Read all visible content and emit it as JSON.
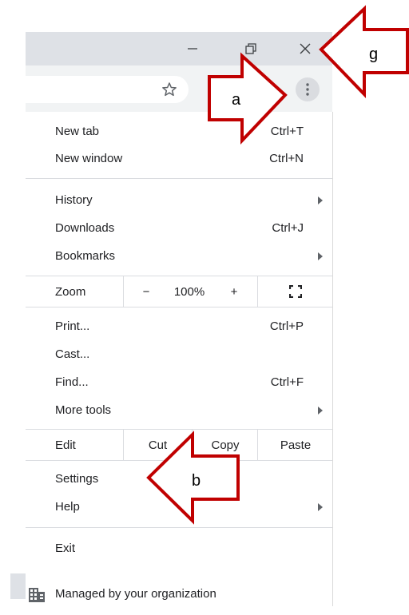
{
  "window": {
    "minimize_icon": "minimize-icon",
    "restore_icon": "restore-icon",
    "close_icon": "close-icon"
  },
  "toolbar": {
    "star_icon": "star-icon",
    "menu_icon": "three-dots-vertical-icon"
  },
  "menu": {
    "new_tab": {
      "label": "New tab",
      "shortcut": "Ctrl+T"
    },
    "new_window": {
      "label": "New window",
      "shortcut": "Ctrl+N"
    },
    "history": {
      "label": "History"
    },
    "downloads": {
      "label": "Downloads",
      "shortcut": "Ctrl+J"
    },
    "bookmarks": {
      "label": "Bookmarks"
    },
    "zoom": {
      "label": "Zoom",
      "minus": "−",
      "value": "100%",
      "plus": "+",
      "fullscreen_icon": "fullscreen-icon"
    },
    "print": {
      "label": "Print...",
      "shortcut": "Ctrl+P"
    },
    "cast": {
      "label": "Cast..."
    },
    "find": {
      "label": "Find...",
      "shortcut": "Ctrl+F"
    },
    "more_tools": {
      "label": "More tools"
    },
    "edit": {
      "label": "Edit",
      "cut": "Cut",
      "copy": "Copy",
      "paste": "Paste"
    },
    "settings": {
      "label": "Settings"
    },
    "help": {
      "label": "Help"
    },
    "exit": {
      "label": "Exit"
    },
    "managed": {
      "label": "Managed by your organization",
      "icon": "building-icon"
    }
  },
  "annotations": {
    "a": "a",
    "b": "b",
    "g": "g",
    "color": "#c00000"
  }
}
